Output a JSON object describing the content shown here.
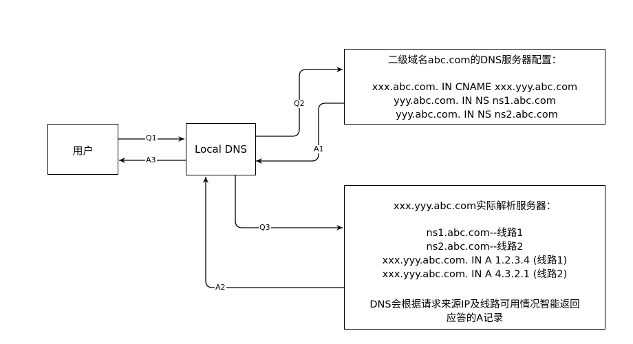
{
  "nodes": {
    "user": {
      "label": "用户"
    },
    "local_dns": {
      "label": "Local DNS"
    },
    "secondary_dns": {
      "title": "二级域名abc.com的DNS服务器配置：",
      "lines": [
        "xxx.abc.com. IN CNAME xxx.yyy.abc.com",
        "yyy.abc.com. IN NS ns1.abc.com",
        "yyy.abc.com. IN NS ns2.abc.com"
      ]
    },
    "resolver": {
      "title": "xxx.yyy.abc.com实际解析服务器：",
      "lines": [
        "ns1.abc.com--线路1",
        "ns2.abc.com--线路2",
        "xxx.yyy.abc.com. IN A 1.2.3.4 (线路1)",
        "xxx.yyy.abc.com. IN A 4.3.2.1 (线路2)"
      ],
      "note_lines": [
        "DNS会根据请求来源IP及线路可用情况智能返回",
        "应答的A记录"
      ]
    }
  },
  "edges": {
    "q1": "Q1",
    "a3": "A3",
    "q2": "Q2",
    "a1": "A1",
    "q3": "Q3",
    "a2": "A2"
  }
}
